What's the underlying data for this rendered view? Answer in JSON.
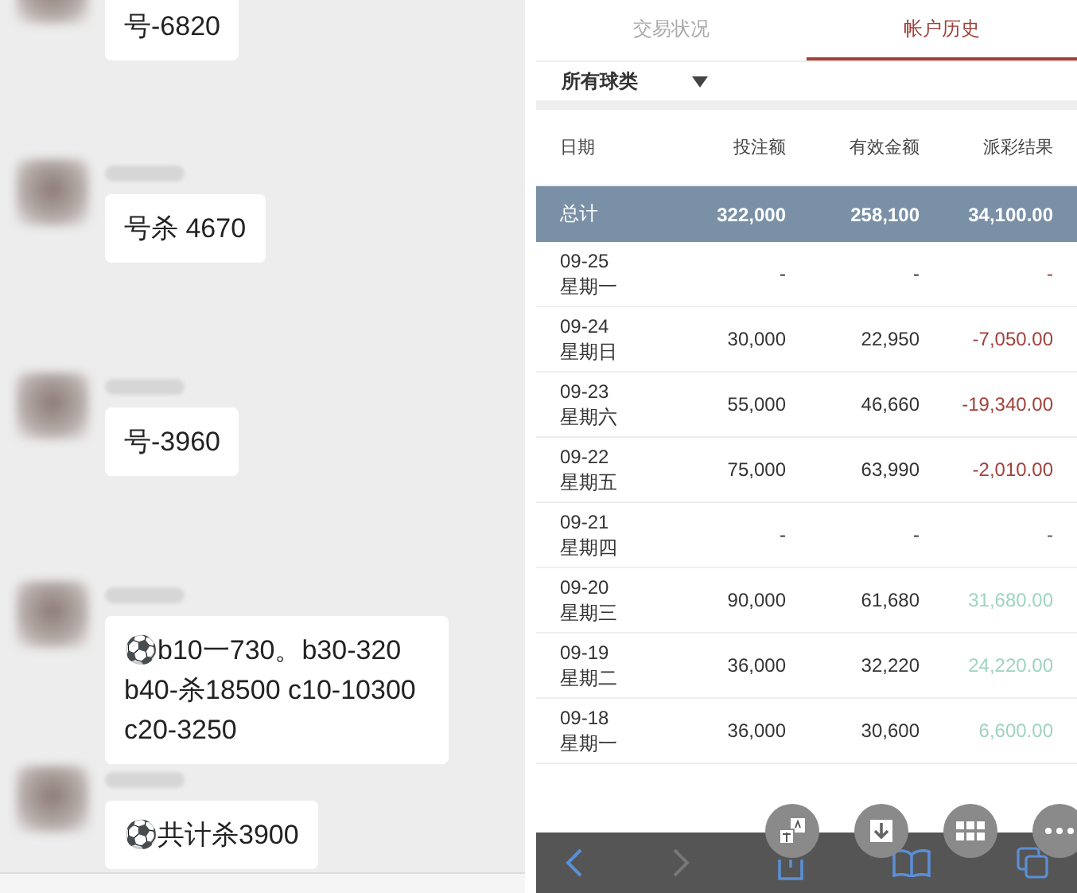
{
  "chat": {
    "messages": [
      {
        "text": "号-6820"
      },
      {
        "text": "号杀 4670"
      },
      {
        "text": "号-3960"
      },
      {
        "text": "⚽b10一730。b30-320 b40-杀18500 c10-10300 c20-3250"
      },
      {
        "text": "⚽共计杀3900"
      }
    ]
  },
  "history": {
    "tabs": [
      {
        "label": "交易状况",
        "selected": false
      },
      {
        "label": "帐户历史",
        "selected": true
      }
    ],
    "filter": {
      "value": "所有球类"
    },
    "table": {
      "columns": [
        "日期",
        "投注额",
        "有效金额",
        "派彩结果"
      ],
      "total": {
        "label": "总计",
        "stake": "322,000",
        "valid": "258,100",
        "result": "34,100.00"
      },
      "rows": [
        {
          "date": "09-25",
          "weekday": "星期一",
          "stake": "-",
          "valid": "-",
          "result": "-",
          "color": "#a0413a"
        },
        {
          "date": "09-24",
          "weekday": "星期日",
          "stake": "30,000",
          "valid": "22,950",
          "result": "-7,050.00",
          "color": "#a0413a"
        },
        {
          "date": "09-23",
          "weekday": "星期六",
          "stake": "55,000",
          "valid": "46,660",
          "result": "-19,340.00",
          "color": "#a0413a"
        },
        {
          "date": "09-22",
          "weekday": "星期五",
          "stake": "75,000",
          "valid": "63,990",
          "result": "-2,010.00",
          "color": "#a0413a"
        },
        {
          "date": "09-21",
          "weekday": "星期四",
          "stake": "-",
          "valid": "-",
          "result": "-",
          "color": "#555555"
        },
        {
          "date": "09-20",
          "weekday": "星期三",
          "stake": "90,000",
          "valid": "61,680",
          "result": "31,680.00",
          "color": "#9ed3c0"
        },
        {
          "date": "09-19",
          "weekday": "星期二",
          "stake": "36,000",
          "valid": "32,220",
          "result": "24,220.00",
          "color": "#9ed3c0"
        },
        {
          "date": "09-18",
          "weekday": "星期一",
          "stake": "36,000",
          "valid": "30,600",
          "result": "6,600.00",
          "color": "#9ed3c0"
        }
      ]
    }
  }
}
